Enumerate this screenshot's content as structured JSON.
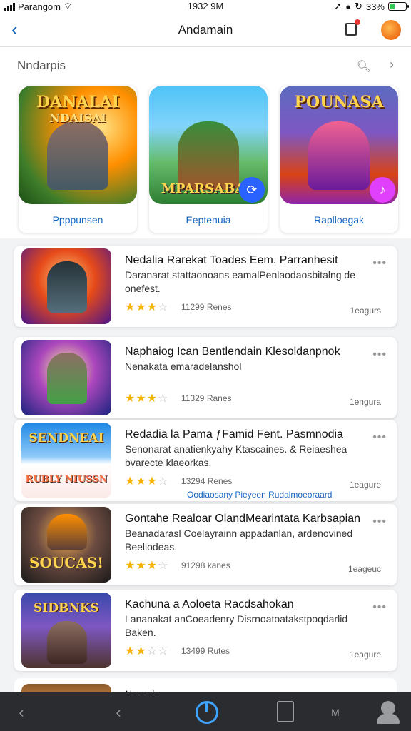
{
  "status_bar": {
    "carrier": "Parangom",
    "time": "1932 9M",
    "battery": "33%",
    "battery_level": 0.33
  },
  "nav": {
    "title": "Andamain"
  },
  "section": {
    "label": "Nndarpis",
    "more": "›"
  },
  "featured": [
    {
      "art_line1": "DANALAI",
      "art_line2": "NDAISAI",
      "art_line3": "",
      "caption": "Ppppunsen"
    },
    {
      "art_line1": "",
      "art_line2": "",
      "art_line3": "MPARSABAR",
      "caption": "Eeptenuia"
    },
    {
      "art_line1": "POUNASA",
      "art_line2": "",
      "art_line3": "",
      "caption": "Raplloegak"
    }
  ],
  "apps": [
    {
      "title": "Nedalia Rarekat Toades Eem. Parranhesit",
      "desc": "Daranarat stattaonoans eamalPenlaodaosbitalng de onefest.",
      "stars": 3,
      "reviews": "11299  Renes",
      "meta": "1eagurs",
      "thumb_t1": "",
      "thumb_t2": "",
      "link": ""
    },
    {
      "title": "Naphaiog Ican Bentlendain Klesoldanpnok",
      "desc": "Nenakata emaradelanshol",
      "stars": 3,
      "reviews": "11329  Ranes",
      "meta": "1engura",
      "thumb_t1": "",
      "thumb_t2": "",
      "link": ""
    },
    {
      "title": "Redadia la Pama ƒFamid Fent. Pasmnodia",
      "desc": "Senonarat anatienkyahy Ktascaines. & Reiaeshea bvarecte klaeorkas.",
      "stars": 3,
      "reviews": "13294  Renes",
      "meta": "1eagure",
      "thumb_t1": "SENDNEAI",
      "thumb_t2": "RUBLY NIUSSN",
      "link": "Oodiaosany Pieyeen Rudalmoeoraard"
    },
    {
      "title": "Gontahe Realoar OlandMearintata Karbsapian",
      "desc": "Beanadarasl Coelayrainn appadanlan, ardenovined Beeliodeas.",
      "stars": 3,
      "reviews": "91298  kanes",
      "meta": "1eageuc",
      "thumb_t1": "",
      "thumb_t2": "SOUCAS!",
      "link": ""
    },
    {
      "title": "Kachuna a Aoloeta Racdsahokan",
      "desc": "Lananakat anCoeadenry Disrnoatoatakstpoqdarlid Baken.",
      "stars": 2,
      "reviews": "13499  Rutes",
      "meta": "1eagure",
      "thumb_t1": "SIDBNKS",
      "thumb_t2": "",
      "link": ""
    }
  ],
  "peek": {
    "title": "Neoadu"
  },
  "tabbar": {
    "labels": [
      "",
      "",
      "",
      "",
      "M",
      ""
    ]
  },
  "colors": {
    "accent": "#1565c0",
    "tab_active": "#3ea2ff",
    "star": "#f4b400",
    "tabbar_bg": "#2b2c2f"
  }
}
